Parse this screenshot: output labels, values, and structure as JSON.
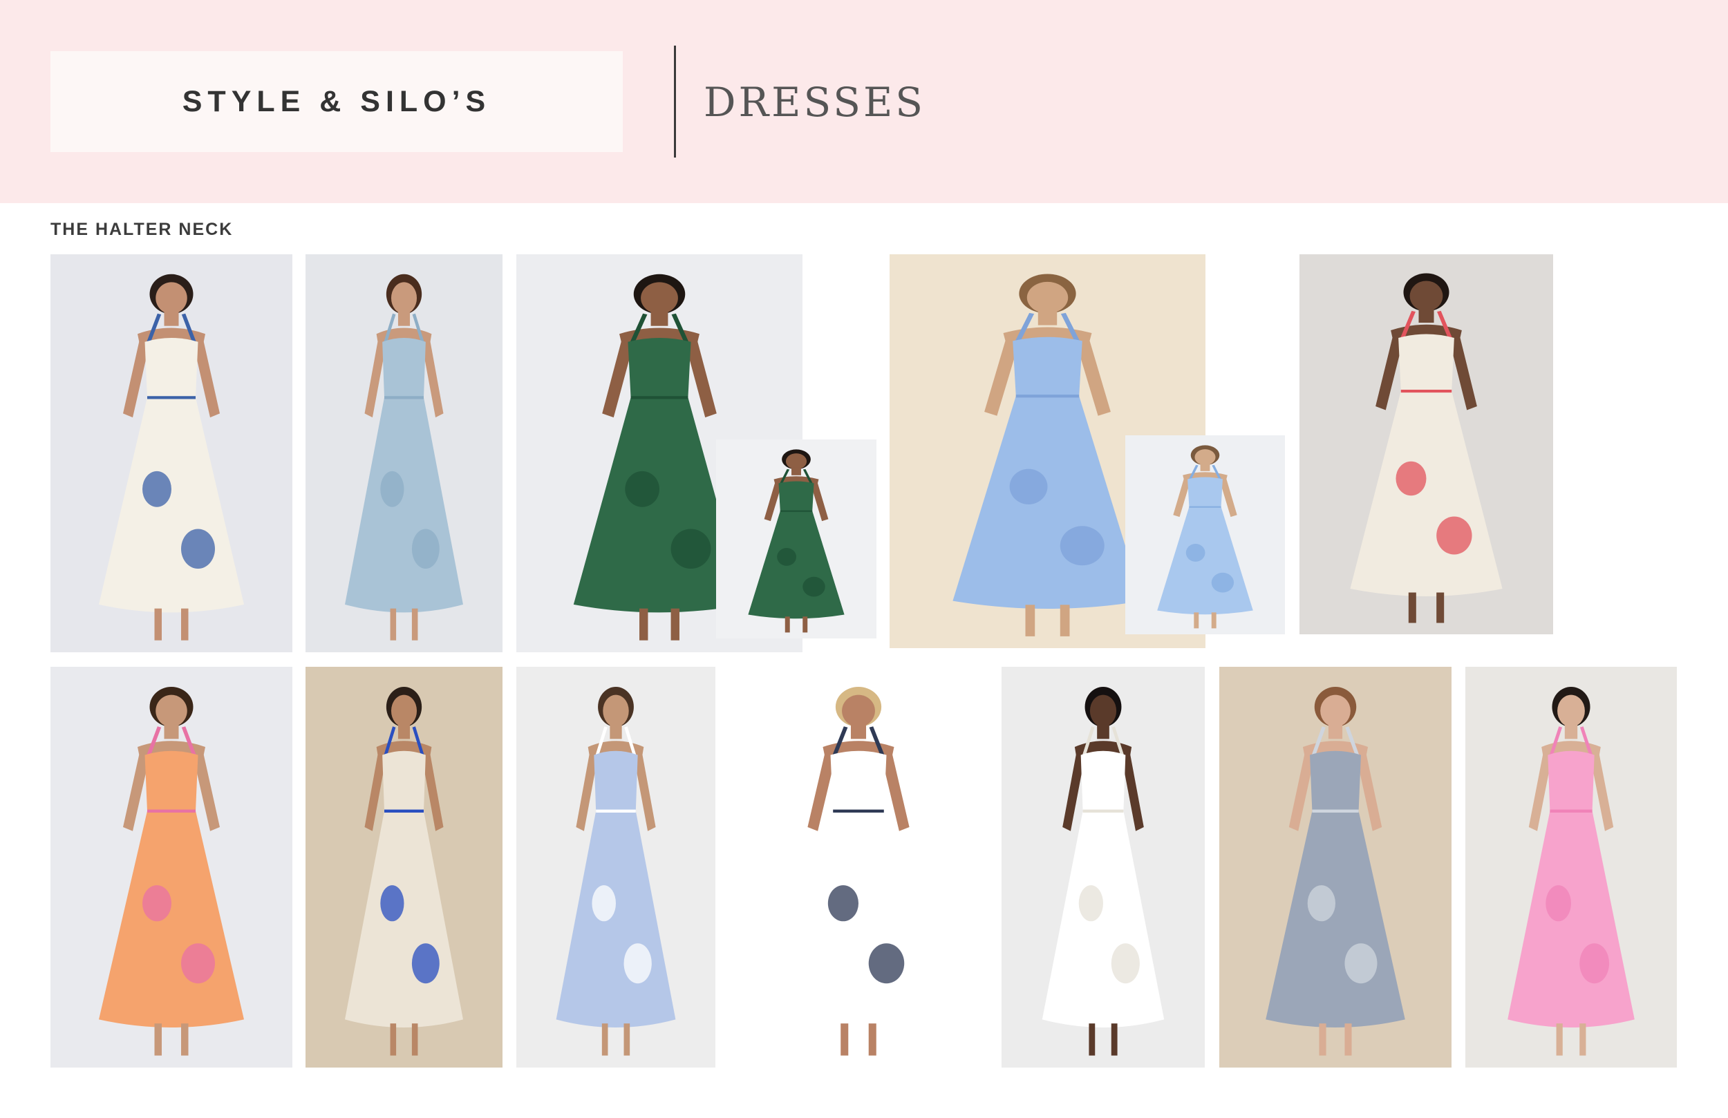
{
  "header": {
    "brand": "STYLE & SILO’S",
    "title": "DRESSES"
  },
  "section": {
    "label": "THE HALTER NECK"
  },
  "carousel": {
    "prev_icon": "chevron-left-icon",
    "prev_glyph": "‹"
  },
  "products": [
    {
      "bg": "#e6e7ec",
      "dress": "#f4f0e6",
      "accent": "#3c62a8",
      "skin": "#c39073",
      "hair": "#2a1e19"
    },
    {
      "bg": "#e4e6ea",
      "dress": "#a9c3d6",
      "accent": "#8eaec6",
      "skin": "#c99a7c",
      "hair": "#4a2d1e"
    },
    {
      "bg": "#ecedf0",
      "dress": "#2f6a48",
      "accent": "#1f5236",
      "skin": "#8e5f44",
      "hair": "#1e1612"
    },
    {
      "bg": "#f0f1f3",
      "dress": "#2f6a48",
      "accent": "#1f5236",
      "skin": "#8e5f44",
      "hair": "#1e1612"
    },
    {
      "bg": "#efe3cf",
      "dress": "#9cbde9",
      "accent": "#7fa3d9",
      "skin": "#d0a582",
      "hair": "#8a6441"
    },
    {
      "bg": "#eef0f3",
      "dress": "#a9c8ee",
      "accent": "#86aee0",
      "skin": "#d3ab8a",
      "hair": "#7a5a3e"
    },
    {
      "bg": "#dedbd8",
      "dress": "#f1ebe0",
      "accent": "#e2545d",
      "skin": "#6f4a36",
      "hair": "#1f1612"
    },
    {
      "bg": "#e9eaee",
      "dress": "#f5a36d",
      "accent": "#e872a4",
      "skin": "#c79879",
      "hair": "#3a2618"
    },
    {
      "bg": "#d8c9b2",
      "dress": "#ece4d6",
      "accent": "#2a4fc0",
      "skin": "#b98766",
      "hair": "#2b1f18"
    },
    {
      "bg": "#ededed",
      "dress": "#b5c7e8",
      "accent": "#ffffff",
      "skin": "#c49777",
      "hair": "#4a3324"
    },
    {
      "bg": "#ffffff",
      "dress": "#ffffff",
      "accent": "#2f3a55",
      "skin": "#b98265",
      "hair": "#d6b884"
    },
    {
      "bg": "#ececec",
      "dress": "#ffffff",
      "accent": "#e6e2d8",
      "skin": "#5a3a2a",
      "hair": "#151010"
    },
    {
      "bg": "#dccdb8",
      "dress": "#9ba6b8",
      "accent": "#cfd5de",
      "skin": "#d9ad94",
      "hair": "#8a5a3b"
    },
    {
      "bg": "#e9e7e3",
      "dress": "#f7a3cc",
      "accent": "#f083b8",
      "skin": "#d8b096",
      "hair": "#221a16"
    }
  ]
}
